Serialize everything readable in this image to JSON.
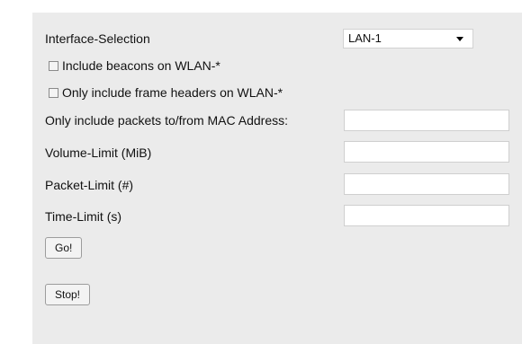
{
  "form": {
    "interface_label": "Interface-Selection",
    "interface_value": "LAN-1",
    "include_beacons_label": "Include beacons on WLAN-*",
    "include_beacons_checked": false,
    "frame_headers_label": "Only include frame headers on WLAN-*",
    "frame_headers_checked": false,
    "mac_label": "Only include packets to/from MAC Address:",
    "mac_value": "",
    "volume_label": "Volume-Limit (MiB)",
    "volume_value": "",
    "packet_label": "Packet-Limit (#)",
    "packet_value": "",
    "time_label": "Time-Limit (s)",
    "time_value": "",
    "go_label": "Go!",
    "stop_label": "Stop!"
  },
  "icons": {
    "dropdown": "chevron-down-icon"
  },
  "colors": {
    "panel_bg": "#ebebeb",
    "field_bg": "#ffffff"
  }
}
